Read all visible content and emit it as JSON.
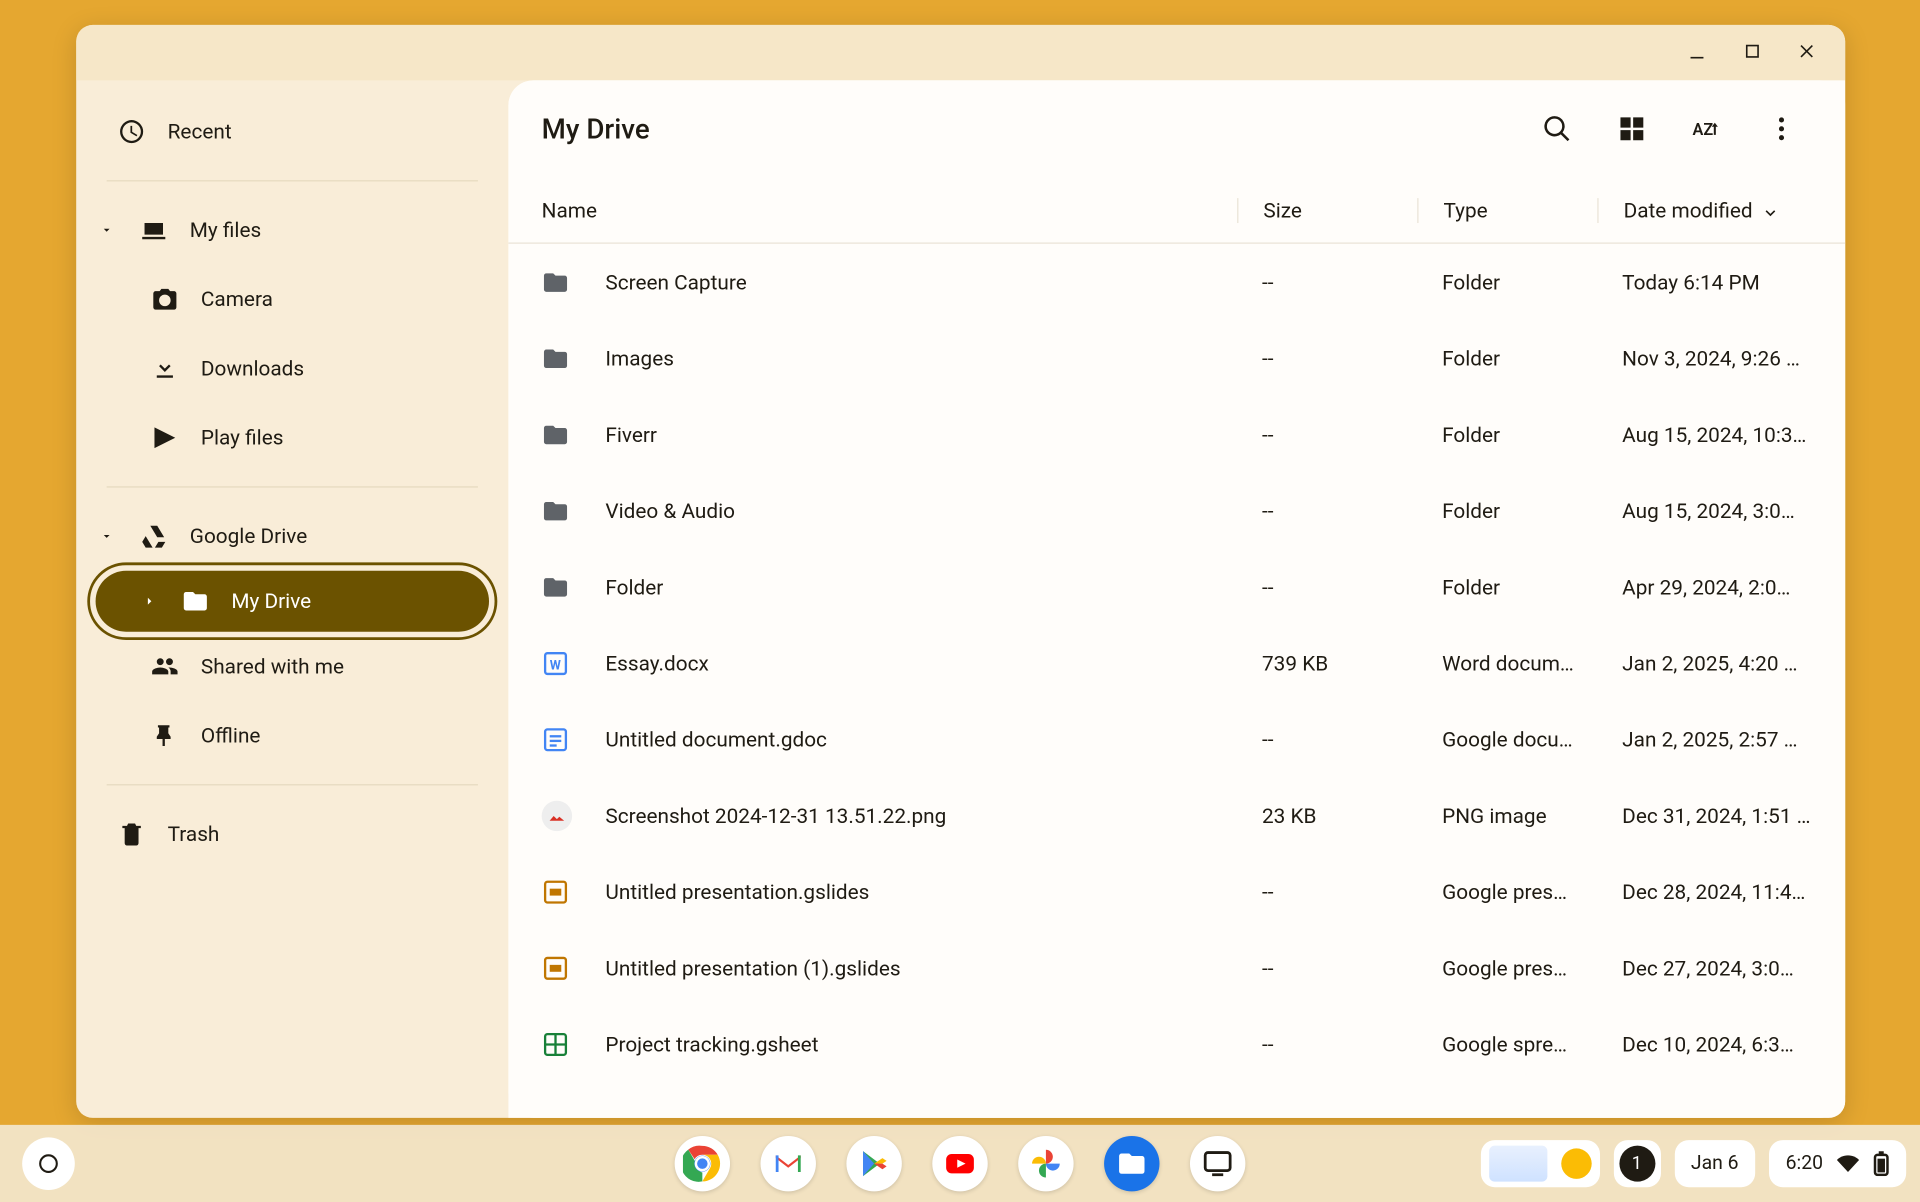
{
  "window": {
    "controls": {
      "minimize": "minimize",
      "maximize": "maximize",
      "close": "close"
    }
  },
  "sidebar": {
    "recent": "Recent",
    "my_files": "My files",
    "camera": "Camera",
    "downloads": "Downloads",
    "play_files": "Play files",
    "google_drive": "Google Drive",
    "my_drive": "My Drive",
    "shared_with_me": "Shared with me",
    "offline": "Offline",
    "trash": "Trash"
  },
  "main": {
    "title": "My Drive",
    "columns": {
      "name": "Name",
      "size": "Size",
      "type": "Type",
      "date": "Date modified"
    },
    "rows": [
      {
        "icon": "folder",
        "name": "Screen Capture",
        "size": "--",
        "type": "Folder",
        "date": "Today 6:14 PM"
      },
      {
        "icon": "folder",
        "name": "Images",
        "size": "--",
        "type": "Folder",
        "date": "Nov 3, 2024, 9:26 …"
      },
      {
        "icon": "folder",
        "name": "Fiverr",
        "size": "--",
        "type": "Folder",
        "date": "Aug 15, 2024, 10:3…"
      },
      {
        "icon": "folder",
        "name": "Video & Audio",
        "size": "--",
        "type": "Folder",
        "date": "Aug 15, 2024, 3:0…"
      },
      {
        "icon": "folder",
        "name": "Folder",
        "size": "--",
        "type": "Folder",
        "date": "Apr 29, 2024, 2:0…"
      },
      {
        "icon": "word",
        "name": "Essay.docx",
        "size": "739 KB",
        "type": "Word docum…",
        "date": "Jan 2, 2025, 4:20 …"
      },
      {
        "icon": "gdoc",
        "name": "Untitled document.gdoc",
        "size": "--",
        "type": "Google docu…",
        "date": "Jan 2, 2025, 2:57 …"
      },
      {
        "icon": "png",
        "name": "Screenshot 2024-12-31 13.51.22.png",
        "size": "23 KB",
        "type": "PNG image",
        "date": "Dec 31, 2024, 1:51 …"
      },
      {
        "icon": "gslides",
        "name": "Untitled presentation.gslides",
        "size": "--",
        "type": "Google pres…",
        "date": "Dec 28, 2024, 11:4…"
      },
      {
        "icon": "gslides",
        "name": "Untitled presentation (1).gslides",
        "size": "--",
        "type": "Google pres…",
        "date": "Dec 27, 2024, 3:0…"
      },
      {
        "icon": "gsheet",
        "name": "Project tracking.gsheet",
        "size": "--",
        "type": "Google spre…",
        "date": "Dec 10, 2024, 6:3…"
      }
    ]
  },
  "shelf": {
    "notification_count": "1",
    "date": "Jan 6",
    "time": "6:20"
  }
}
